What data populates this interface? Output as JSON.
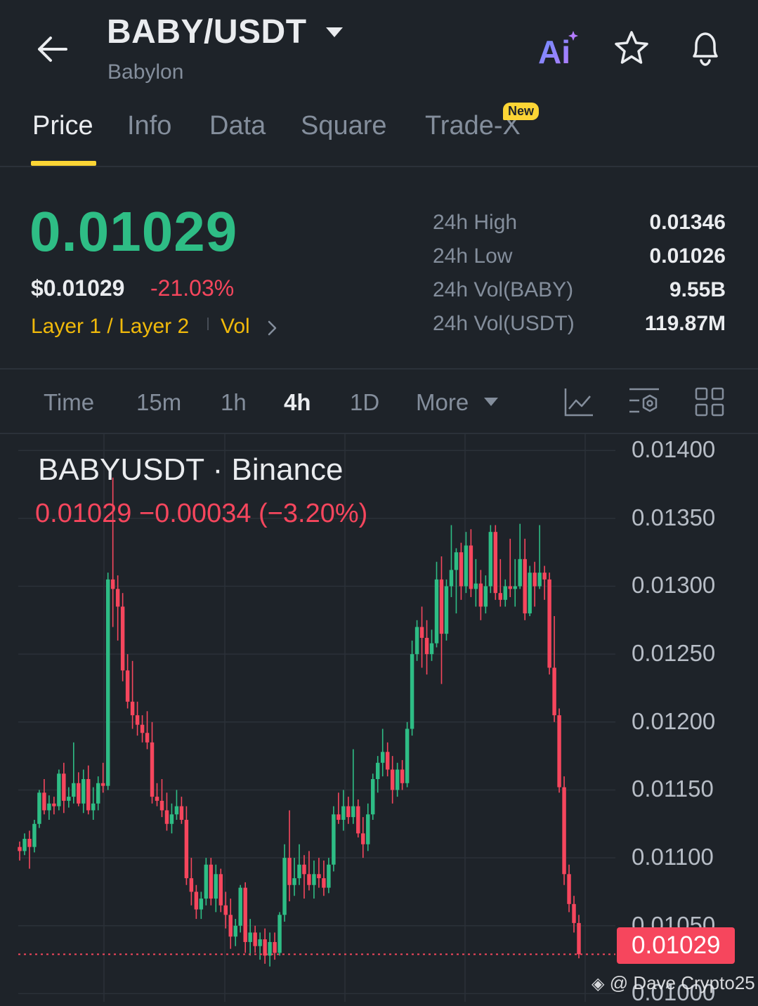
{
  "header": {
    "pair": "BABY/USDT",
    "name": "Babylon",
    "ai_label": "Ai"
  },
  "tabs": [
    {
      "label": "Price",
      "active": true
    },
    {
      "label": "Info"
    },
    {
      "label": "Data"
    },
    {
      "label": "Square"
    },
    {
      "label": "Trade-X",
      "badge": "New"
    }
  ],
  "summary": {
    "last_price": "0.01029",
    "usd_price": "$0.01029",
    "change_pct": "-21.03%",
    "tags": [
      "Layer 1 / Layer 2",
      "Vol"
    ],
    "stats": [
      {
        "label": "24h High",
        "value": "0.01346"
      },
      {
        "label": "24h Low",
        "value": "0.01026"
      },
      {
        "label": "24h Vol(BABY)",
        "value": "9.55B"
      },
      {
        "label": "24h Vol(USDT)",
        "value": "119.87M"
      }
    ]
  },
  "intervals": {
    "items": [
      "Time",
      "15m",
      "1h",
      "4h",
      "1D",
      "More"
    ],
    "active": "4h"
  },
  "chart": {
    "title": "BABYUSDT · Binance",
    "ohlc_line": "0.01029  −0.00034 (−3.20%)",
    "last_label": "0.01029",
    "watermark": "@ Dave Crypto25"
  },
  "colors": {
    "up": "#2ebd85",
    "down": "#f6465d",
    "accent": "#fcd535",
    "background": "#1e2329"
  },
  "chart_data": {
    "type": "candlestick",
    "yticks": [
      "0.01400",
      "0.01350",
      "0.01300",
      "0.01250",
      "0.01200",
      "0.01150",
      "0.01100",
      "0.01050",
      "0.01000"
    ],
    "ylim": [
      0.00994,
      0.01412
    ],
    "last": 0.01029,
    "candles": [
      [
        0.01108,
        0.01112,
        0.01098,
        0.01105
      ],
      [
        0.01105,
        0.01118,
        0.01102,
        0.01114
      ],
      [
        0.01114,
        0.0112,
        0.01092,
        0.01108
      ],
      [
        0.01108,
        0.01128,
        0.01104,
        0.01125
      ],
      [
        0.01125,
        0.0115,
        0.01122,
        0.01148
      ],
      [
        0.01148,
        0.01158,
        0.01132,
        0.01135
      ],
      [
        0.01135,
        0.01146,
        0.01128,
        0.0114
      ],
      [
        0.0114,
        0.01145,
        0.01132,
        0.01138
      ],
      [
        0.01138,
        0.01165,
        0.01135,
        0.01162
      ],
      [
        0.01162,
        0.0117,
        0.01133,
        0.01142
      ],
      [
        0.01142,
        0.01152,
        0.01137,
        0.01145
      ],
      [
        0.01145,
        0.01185,
        0.0114,
        0.01155
      ],
      [
        0.01155,
        0.01163,
        0.01138,
        0.0114
      ],
      [
        0.0114,
        0.01165,
        0.01133,
        0.01158
      ],
      [
        0.01158,
        0.01168,
        0.01132,
        0.01135
      ],
      [
        0.01135,
        0.01152,
        0.01128,
        0.0114
      ],
      [
        0.0114,
        0.0116,
        0.01135,
        0.01155
      ],
      [
        0.01155,
        0.0117,
        0.01148,
        0.01153
      ],
      [
        0.01153,
        0.0131,
        0.0115,
        0.01305
      ],
      [
        0.01305,
        0.0138,
        0.0127,
        0.01298
      ],
      [
        0.01298,
        0.01308,
        0.0126,
        0.01285
      ],
      [
        0.01285,
        0.01295,
        0.0123,
        0.01238
      ],
      [
        0.01238,
        0.0125,
        0.0121,
        0.01215
      ],
      [
        0.01215,
        0.01245,
        0.01195,
        0.01205
      ],
      [
        0.01205,
        0.01215,
        0.0119,
        0.01198
      ],
      [
        0.01198,
        0.01205,
        0.01185,
        0.01192
      ],
      [
        0.01192,
        0.01208,
        0.0118,
        0.01185
      ],
      [
        0.01185,
        0.012,
        0.0114,
        0.01145
      ],
      [
        0.01145,
        0.01155,
        0.01138,
        0.01142
      ],
      [
        0.01142,
        0.01158,
        0.0113,
        0.01135
      ],
      [
        0.01135,
        0.01148,
        0.0112,
        0.01125
      ],
      [
        0.01125,
        0.0114,
        0.01118,
        0.01132
      ],
      [
        0.01132,
        0.0115,
        0.01128,
        0.01138
      ],
      [
        0.01138,
        0.01145,
        0.01125,
        0.01128
      ],
      [
        0.01128,
        0.01138,
        0.0108,
        0.01085
      ],
      [
        0.01085,
        0.011,
        0.01065,
        0.01075
      ],
      [
        0.01075,
        0.0108,
        0.01055,
        0.01062
      ],
      [
        0.01062,
        0.01075,
        0.01055,
        0.0107
      ],
      [
        0.0107,
        0.011,
        0.01065,
        0.01095
      ],
      [
        0.01095,
        0.011,
        0.01065,
        0.0107
      ],
      [
        0.0107,
        0.01095,
        0.0106,
        0.01088
      ],
      [
        0.01088,
        0.01092,
        0.0106,
        0.01065
      ],
      [
        0.01065,
        0.01075,
        0.01048,
        0.01058
      ],
      [
        0.01058,
        0.0107,
        0.01033,
        0.01042
      ],
      [
        0.01042,
        0.01055,
        0.01035,
        0.0105
      ],
      [
        0.0105,
        0.0108,
        0.01045,
        0.01078
      ],
      [
        0.01078,
        0.01082,
        0.0103,
        0.01038
      ],
      [
        0.01038,
        0.01055,
        0.01028,
        0.01045
      ],
      [
        0.01045,
        0.0105,
        0.0103,
        0.01035
      ],
      [
        0.01035,
        0.01045,
        0.01025,
        0.0104
      ],
      [
        0.0104,
        0.01048,
        0.01022,
        0.01028
      ],
      [
        0.01028,
        0.01045,
        0.0102,
        0.01038
      ],
      [
        0.01038,
        0.01045,
        0.01025,
        0.0103
      ],
      [
        0.0103,
        0.0106,
        0.01028,
        0.01058
      ],
      [
        0.01058,
        0.0111,
        0.01053,
        0.011
      ],
      [
        0.011,
        0.01135,
        0.01068,
        0.0108
      ],
      [
        0.0108,
        0.011,
        0.01072,
        0.01085
      ],
      [
        0.01085,
        0.0111,
        0.0108,
        0.01095
      ],
      [
        0.01095,
        0.01102,
        0.0107,
        0.01088
      ],
      [
        0.01088,
        0.01105,
        0.01076,
        0.0108
      ],
      [
        0.0108,
        0.01098,
        0.0107,
        0.01088
      ],
      [
        0.01088,
        0.011,
        0.01078,
        0.01085
      ],
      [
        0.01085,
        0.01098,
        0.01072,
        0.01078
      ],
      [
        0.01078,
        0.011,
        0.01074,
        0.01095
      ],
      [
        0.01095,
        0.01138,
        0.0109,
        0.01132
      ],
      [
        0.01132,
        0.01148,
        0.01125,
        0.01128
      ],
      [
        0.01128,
        0.0115,
        0.0112,
        0.01138
      ],
      [
        0.01138,
        0.01145,
        0.01125,
        0.0113
      ],
      [
        0.0113,
        0.0118,
        0.01125,
        0.01138
      ],
      [
        0.01138,
        0.01143,
        0.01115,
        0.01118
      ],
      [
        0.01118,
        0.0113,
        0.011,
        0.0111
      ],
      [
        0.0111,
        0.0114,
        0.01105,
        0.01132
      ],
      [
        0.01132,
        0.01162,
        0.01128,
        0.01158
      ],
      [
        0.01158,
        0.01175,
        0.01148,
        0.0117
      ],
      [
        0.0117,
        0.01195,
        0.0116,
        0.01178
      ],
      [
        0.01178,
        0.01185,
        0.0116,
        0.01165
      ],
      [
        0.01165,
        0.01175,
        0.0114,
        0.0115
      ],
      [
        0.0115,
        0.0117,
        0.01145,
        0.01165
      ],
      [
        0.01165,
        0.01172,
        0.0115,
        0.01155
      ],
      [
        0.01155,
        0.012,
        0.01152,
        0.01195
      ],
      [
        0.01195,
        0.0126,
        0.0119,
        0.0125
      ],
      [
        0.0125,
        0.01275,
        0.01245,
        0.0127
      ],
      [
        0.0127,
        0.01285,
        0.0124,
        0.01262
      ],
      [
        0.01262,
        0.01275,
        0.01235,
        0.0125
      ],
      [
        0.0125,
        0.01268,
        0.01245,
        0.01258
      ],
      [
        0.01258,
        0.01318,
        0.01255,
        0.01305
      ],
      [
        0.01305,
        0.01322,
        0.01228,
        0.01265
      ],
      [
        0.01265,
        0.01305,
        0.0126,
        0.013
      ],
      [
        0.013,
        0.01345,
        0.01292,
        0.01312
      ],
      [
        0.01312,
        0.01328,
        0.0128,
        0.01325
      ],
      [
        0.01325,
        0.01332,
        0.0129,
        0.013
      ],
      [
        0.013,
        0.0134,
        0.01295,
        0.0133
      ],
      [
        0.0133,
        0.01342,
        0.01292,
        0.01298
      ],
      [
        0.01298,
        0.0132,
        0.01285,
        0.01302
      ],
      [
        0.01302,
        0.01312,
        0.01275,
        0.01285
      ],
      [
        0.01285,
        0.01308,
        0.0128,
        0.013
      ],
      [
        0.013,
        0.01345,
        0.01295,
        0.0134
      ],
      [
        0.0134,
        0.01345,
        0.0129,
        0.01295
      ],
      [
        0.01295,
        0.0132,
        0.01285,
        0.0129
      ],
      [
        0.0129,
        0.01305,
        0.01285,
        0.013
      ],
      [
        0.013,
        0.01335,
        0.01292,
        0.01298
      ],
      [
        0.01298,
        0.0132,
        0.01285,
        0.013
      ],
      [
        0.013,
        0.01346,
        0.01298,
        0.0132
      ],
      [
        0.0132,
        0.01335,
        0.01275,
        0.0128
      ],
      [
        0.0128,
        0.01315,
        0.01278,
        0.0131
      ],
      [
        0.0131,
        0.01318,
        0.01285,
        0.013
      ],
      [
        0.013,
        0.01345,
        0.01298,
        0.0131
      ],
      [
        0.0131,
        0.01315,
        0.0129,
        0.01305
      ],
      [
        0.01305,
        0.0131,
        0.01235,
        0.0124
      ],
      [
        0.0124,
        0.01278,
        0.012,
        0.01205
      ],
      [
        0.01205,
        0.0121,
        0.01148,
        0.01152
      ],
      [
        0.01152,
        0.0116,
        0.0108,
        0.01088
      ],
      [
        0.01088,
        0.01095,
        0.0106,
        0.01066
      ],
      [
        0.01066,
        0.01072,
        0.01045,
        0.01052
      ],
      [
        0.01052,
        0.01058,
        0.01026,
        0.01029
      ]
    ]
  }
}
